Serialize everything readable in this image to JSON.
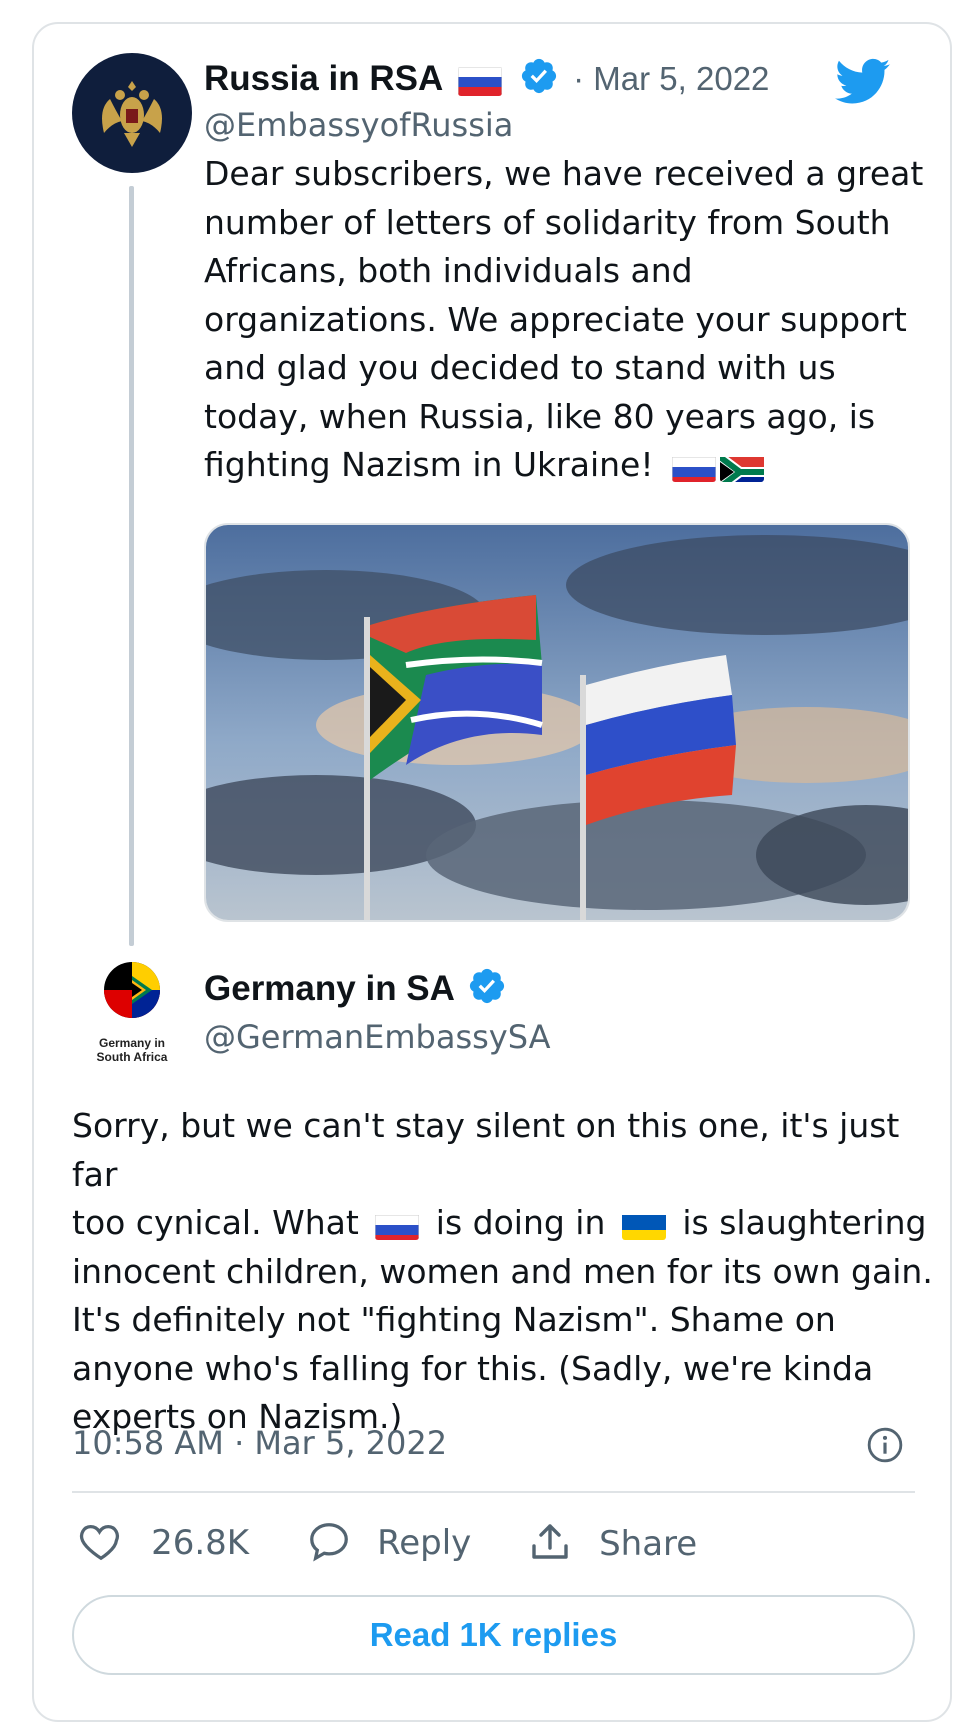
{
  "original_tweet": {
    "display_name": "Russia in RSA",
    "handle": "@EmbassyofRussia",
    "date": "· Mar 5, 2022",
    "text_lines": [
      "Dear subscribers, we have received a great",
      "number of letters of solidarity from South",
      "Africans, both individuals and",
      "organizations. We appreciate your support",
      "and glad you decided to stand with us",
      "today, when Russia, like 80 years ago, is",
      "fighting Nazism in Ukraine!"
    ],
    "icons": [
      "russia-flag-icon",
      "verified-badge-icon",
      "twitter-bird-icon",
      "south-africa-flag-icon"
    ],
    "image": "south-africa-and-russia-flags-against-cloudy-sky"
  },
  "reply_tweet": {
    "display_name": "Germany in SA",
    "handle": "@GermanEmbassySA",
    "avatar_caption": [
      "Germany in",
      "South Africa"
    ],
    "text_lines": [
      [
        "Sorry, but we can't stay silent on this one, it's just far"
      ],
      [
        "too cynical. What ",
        "{flag:russia}",
        " is doing in ",
        "{flag:ukraine}",
        " is slaughtering"
      ],
      [
        "innocent children, women and men for its own gain."
      ],
      [
        "It's definitely not \"fighting Nazism\". Shame on"
      ],
      [
        "anyone who's falling for this. (Sadly, we're kinda"
      ],
      [
        "experts on Nazism.)"
      ]
    ],
    "text_segments": {
      "line2_a": "too cynical. What",
      "line2_b": "is doing in",
      "line2_c": "is slaughtering"
    },
    "timestamp": "10:58 AM · Mar 5, 2022"
  },
  "actions": {
    "likes": "26.8K",
    "reply_label": "Reply",
    "share_label": "Share"
  },
  "read_replies_label": "Read 1K replies",
  "colors": {
    "accent": "#1d9bf0",
    "text_primary": "#0f1419",
    "text_secondary": "#536471",
    "border": "#dfe3e6"
  }
}
